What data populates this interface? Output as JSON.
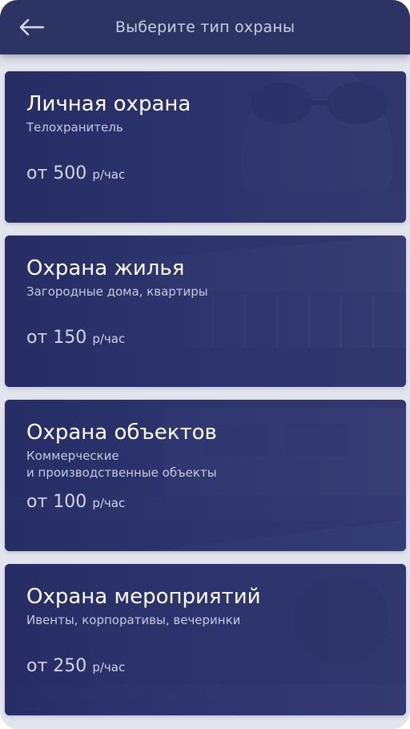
{
  "header": {
    "title": "Выберите тип охраны",
    "back_icon": "arrow-left-icon"
  },
  "cards": [
    {
      "title": "Личная охрана",
      "subtitle": "Телохранитель",
      "price": "от 500",
      "unit": "р/час"
    },
    {
      "title": "Охрана жилья",
      "subtitle": "Загородные дома, квартиры",
      "price": "от 150",
      "unit": "р/час"
    },
    {
      "title": "Охрана объектов",
      "subtitle": "Коммерческие\nи производственные объекты",
      "price": "от 100",
      "unit": "р/час"
    },
    {
      "title": "Охрана мероприятий",
      "subtitle": "Ивенты, корпоративы, вечеринки",
      "price": "от 250",
      "unit": "р/час"
    }
  ],
  "colors": {
    "header_bg": "#2d3463",
    "page_bg": "#e3e5ee",
    "card_overlay": "#2c3268",
    "title_text": "#ffffff",
    "muted_text": "#c5c9e0"
  }
}
